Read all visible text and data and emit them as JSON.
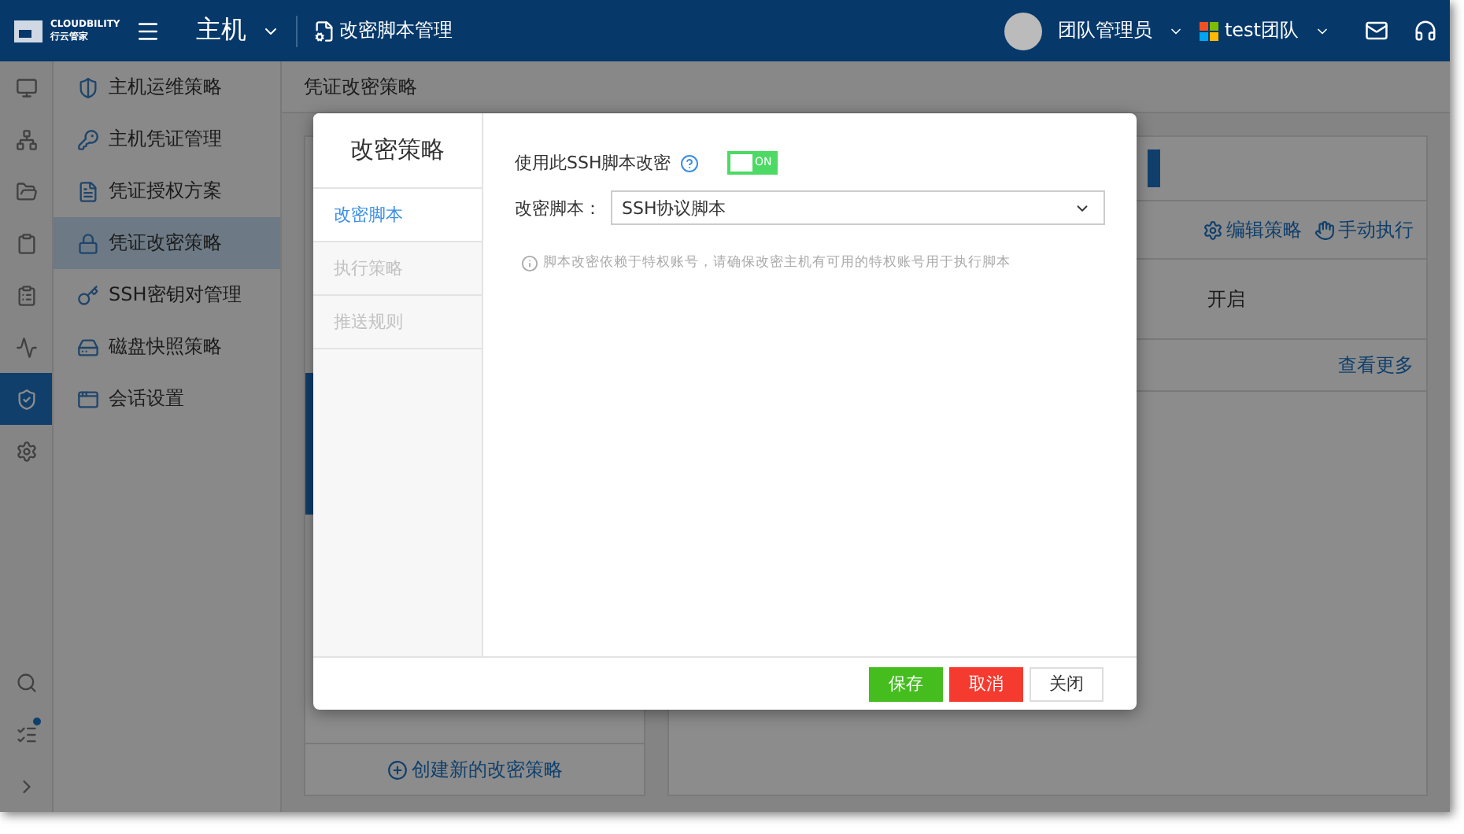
{
  "topbar": {
    "logo_text": "CLOUDBILITY",
    "logo_sub": "行云管家",
    "module": "主机",
    "page_title": "改密脚本管理",
    "user": "团队管理员",
    "team": "test团队"
  },
  "rail": {
    "items": [
      {
        "kind": "monitor",
        "selected": false
      },
      {
        "kind": "network",
        "selected": false
      },
      {
        "kind": "folder",
        "selected": false
      },
      {
        "kind": "clipboard",
        "selected": false
      },
      {
        "kind": "clipboard-list",
        "selected": false
      },
      {
        "kind": "activity",
        "selected": false
      },
      {
        "kind": "shield",
        "selected": true
      },
      {
        "kind": "gear",
        "selected": false
      }
    ],
    "bottom": [
      {
        "kind": "search",
        "badge": false
      },
      {
        "kind": "tasks",
        "badge": true
      },
      {
        "kind": "chevron",
        "badge": false
      }
    ]
  },
  "submenu": [
    {
      "label": "主机运维策略",
      "kind": "shield",
      "selected": false
    },
    {
      "label": "主机凭证管理",
      "kind": "key",
      "selected": false
    },
    {
      "label": "凭证授权方案",
      "kind": "doc",
      "selected": false
    },
    {
      "label": "凭证改密策略",
      "kind": "lock",
      "selected": true
    },
    {
      "label": "SSH密钥对管理",
      "kind": "keypair",
      "selected": false
    },
    {
      "label": "磁盘快照策略",
      "kind": "disk",
      "selected": false
    },
    {
      "label": "会话设置",
      "kind": "window",
      "selected": false
    }
  ],
  "breadcrumb": "凭证改密策略",
  "list_panel": {
    "create_link": "创建新的改密策略"
  },
  "detail_panel": {
    "actions": [
      {
        "label": "编辑策略",
        "kind": "gear"
      },
      {
        "label": "手动执行",
        "kind": "hand"
      }
    ],
    "status_text": "开启",
    "more_link": "查看更多"
  },
  "dialog": {
    "title": "改密策略",
    "tabs": [
      {
        "label": "改密脚本",
        "selected": true,
        "disabled": false
      },
      {
        "label": "执行策略",
        "selected": false,
        "disabled": true
      },
      {
        "label": "推送规则",
        "selected": false,
        "disabled": true
      }
    ],
    "toggle": {
      "label": "使用此SSH脚本改密",
      "on": true,
      "text": "ON"
    },
    "script_field": {
      "label": "改密脚本：",
      "value": "SSH协议脚本"
    },
    "hint": "脚本改密依赖于特权账号，请确保改密主机有可用的特权账号用于执行脚本",
    "buttons": [
      {
        "label": "保存",
        "kind": "primary"
      },
      {
        "label": "取消",
        "kind": "danger"
      },
      {
        "label": "关闭",
        "kind": "default"
      }
    ]
  }
}
